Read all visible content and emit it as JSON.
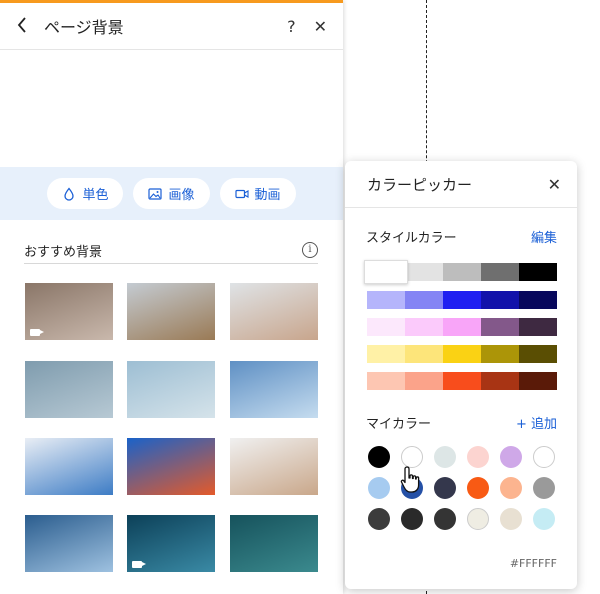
{
  "panel": {
    "title": "ページ背景",
    "back_icon": "chevron-left-icon",
    "help_label": "?",
    "close_label": "✕",
    "media_buttons": [
      {
        "label": "単色",
        "icon": "droplet-icon"
      },
      {
        "label": "画像",
        "icon": "image-icon"
      },
      {
        "label": "動画",
        "icon": "video-icon"
      }
    ],
    "recommended_label": "おすすめ背景",
    "info_label": "i"
  },
  "thumbnails": [
    {
      "name": "shadow-leaves",
      "colors": [
        "#8a7668",
        "#c9b8ac"
      ],
      "video": true
    },
    {
      "name": "mountain-cabin",
      "colors": [
        "#c4cbd2",
        "#9a7a55"
      ],
      "video": false
    },
    {
      "name": "yoga-pose",
      "colors": [
        "#dfe3e6",
        "#c8a58c"
      ],
      "video": false
    },
    {
      "name": "cans-pattern",
      "colors": [
        "#7f9cae",
        "#b7c9d4"
      ],
      "video": false
    },
    {
      "name": "pills-shadow",
      "colors": [
        "#9dbed3",
        "#d5e3ea"
      ],
      "video": false
    },
    {
      "name": "glass-building",
      "colors": [
        "#5f90c4",
        "#c5dcef"
      ],
      "video": false
    },
    {
      "name": "santorini",
      "colors": [
        "#e9eef5",
        "#3d7cc5"
      ],
      "video": false
    },
    {
      "name": "lemon-glass",
      "colors": [
        "#1a62c9",
        "#e45a2a"
      ],
      "video": false
    },
    {
      "name": "tennis-player",
      "colors": [
        "#f0f0f0",
        "#c9a78a"
      ],
      "video": false
    },
    {
      "name": "skyscrapers",
      "colors": [
        "#2b5d8e",
        "#9ec1e0"
      ],
      "video": false
    },
    {
      "name": "underwater-light",
      "colors": [
        "#0c4058",
        "#3a8aa5"
      ],
      "video": true
    },
    {
      "name": "sea-swimmers",
      "colors": [
        "#16525c",
        "#3b8a8e"
      ],
      "video": false
    }
  ],
  "picker": {
    "title": "カラーピッカー",
    "close_label": "✕",
    "style_colors_label": "スタイルカラー",
    "edit_label": "編集",
    "palette": [
      [
        "#ffffff",
        "#e3e3e3",
        "#bdbdbd",
        "#6f6f6f",
        "#000000"
      ],
      [
        "#b5b5fb",
        "#8484f4",
        "#1f1ff1",
        "#1212aa",
        "#08085c"
      ],
      [
        "#fce8fc",
        "#fbcafb",
        "#f8a5f8",
        "#83588a",
        "#3e2941"
      ],
      [
        "#fff1a6",
        "#fde57a",
        "#fad214",
        "#ac9508",
        "#5a4e03"
      ],
      [
        "#fdc6b2",
        "#fba38a",
        "#f84d1c",
        "#a83414",
        "#5a1a08"
      ]
    ],
    "my_colors_label": "マイカラー",
    "add_label": "+ 追加",
    "my_colors": [
      [
        "#000000",
        "#ffffff",
        "#dde6e6",
        "#fcd4d0",
        "#cfa8e8",
        "#ffffff"
      ],
      [
        "#a6cbf0",
        "#2450a6",
        "#34374c",
        "#f85a14",
        "#fcb48f",
        "#9a9a9a"
      ],
      [
        "#3c3c3c",
        "#2a2a2a",
        "#343434",
        "#efede3",
        "#e8e0d2",
        "#c5ecf4"
      ]
    ],
    "hex_value": "#FFFFFF"
  }
}
